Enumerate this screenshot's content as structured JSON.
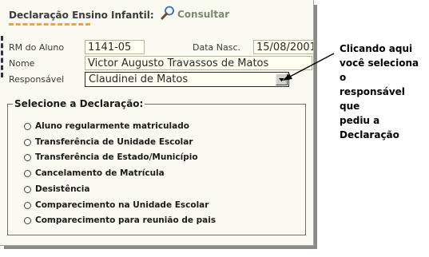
{
  "header": {
    "title": "Declaração Ensino Infantil:",
    "consultar_label": "Consultar"
  },
  "form": {
    "rm_label": "RM do Aluno",
    "rm_value": "1141-05",
    "data_nasc_label": "Data Nasc.",
    "data_nasc_value": "15/08/2001",
    "nome_label": "Nome",
    "nome_value": "Victor Augusto Travassos de Matos",
    "responsavel_label": "Responsável",
    "responsavel_value": "Claudinei de Matos"
  },
  "declaracao": {
    "legend": "Selecione a Declaração:",
    "options": [
      "Aluno regularmente matriculado",
      "Transferência de Unidade Escolar",
      "Transferência de Estado/Município",
      "Cancelamento de Matrícula",
      "Desistência",
      "Comparecimento na Unidade Escolar",
      "Comparecimento para reunião de pais"
    ]
  },
  "callout": {
    "lines": [
      "Clicando aqui",
      "você seleciona o",
      "responsável que",
      "pediu a Declaração"
    ]
  },
  "colors": {
    "panel_bg": "#fbfaf2",
    "title_underline": "#f0a81c",
    "field_bg": "#fffef0"
  },
  "icons": [
    "magnifier-icon",
    "dropdown-arrow-icon",
    "callout-arrow"
  ]
}
